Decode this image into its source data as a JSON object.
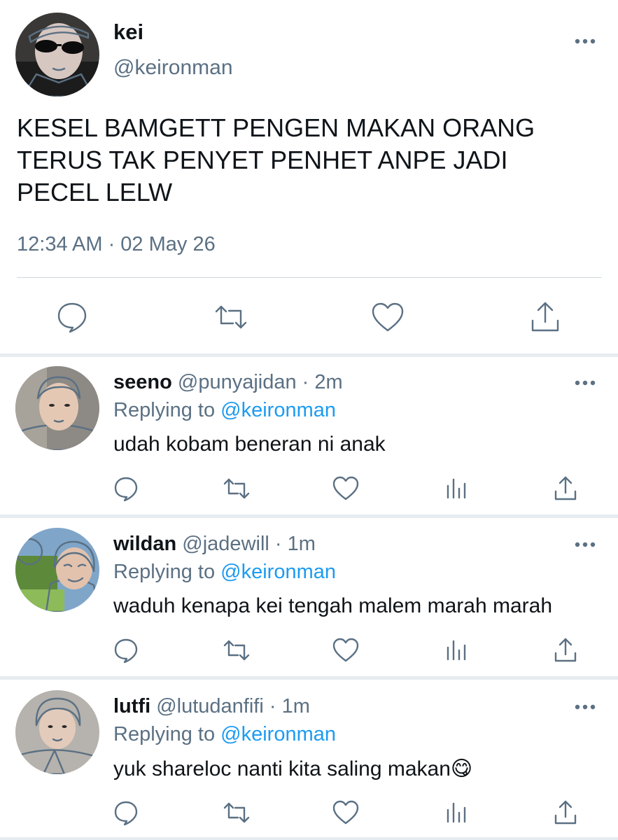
{
  "main_tweet": {
    "name": "kei",
    "handle": "@keironman",
    "text_lines": [
      "KESEL BAMGETT PENGEN MAKAN ORANG",
      "TERUS TAK PENYET PENHET ANPE JADI",
      "PECEL LELW"
    ],
    "timestamp": "12:34 AM · 02 May 26",
    "actions": [
      "reply-icon",
      "retweet-icon",
      "like-icon",
      "share-icon"
    ]
  },
  "replies": [
    {
      "name": "seeno",
      "handle_time": "@punyajidan · 2m",
      "replying_prefix": "Replying to",
      "replying_to": "@keironman",
      "text": "udah kobam beneran ni anak",
      "emoji": ""
    },
    {
      "name": "wildan",
      "handle_time": "@jadewill · 1m",
      "replying_prefix": "Replying to",
      "replying_to": "@keironman",
      "text": "waduh kenapa kei tengah malem marah marah",
      "emoji": ""
    },
    {
      "name": "lutfi",
      "handle_time": "@lutudanfifi · 1m",
      "replying_prefix": "Replying to",
      "replying_to": "@keironman",
      "text": "yuk shareloc nanti kita saling makan",
      "emoji": "😋"
    }
  ],
  "colors": {
    "text": "#0f1419",
    "muted": "#5b7083",
    "link": "#1d9bf0",
    "separator": "#e6ecf0",
    "divider": "#cfd9de"
  }
}
